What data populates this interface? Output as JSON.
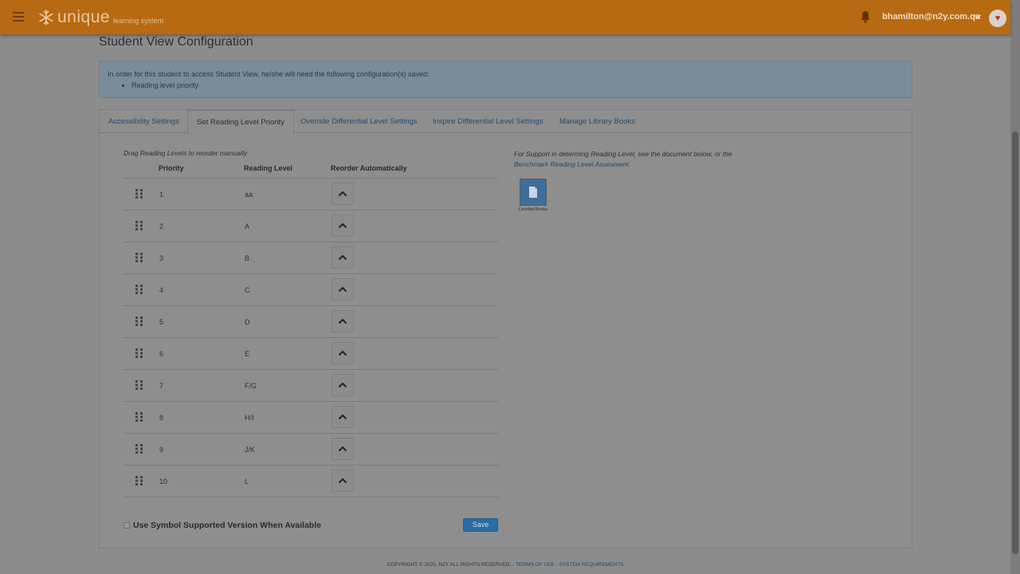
{
  "header": {
    "brand": "unique",
    "brand_sub": "learning system",
    "user_email": "bhamilton@n2y.com.qa"
  },
  "page": {
    "title": "Student View Configuration"
  },
  "notice": {
    "text": "In order for this student to access Student View, he/she will need the following configuration(s) saved:",
    "items": [
      "Reading level priority"
    ]
  },
  "tabs": [
    {
      "label": "Accessibility Settings",
      "active": false
    },
    {
      "label": "Set Reading Level Priority",
      "active": true
    },
    {
      "label": "Override Differential Level Settings",
      "active": false
    },
    {
      "label": "Inspire Differential Level Settings",
      "active": false
    },
    {
      "label": "Manage Library Books",
      "active": false
    }
  ],
  "priority": {
    "instruction": "Drag Reading Levels to reorder manually",
    "columns": {
      "priority": "Priority",
      "reading_level": "Reading Level",
      "reorder": "Reorder Automatically"
    },
    "rows": [
      {
        "priority": "1",
        "level": "aa"
      },
      {
        "priority": "2",
        "level": "A"
      },
      {
        "priority": "3",
        "level": "B"
      },
      {
        "priority": "4",
        "level": "C"
      },
      {
        "priority": "5",
        "level": "D"
      },
      {
        "priority": "6",
        "level": "E"
      },
      {
        "priority": "7",
        "level": "F/G"
      },
      {
        "priority": "8",
        "level": "H/I"
      },
      {
        "priority": "9",
        "level": "J/K"
      },
      {
        "priority": "10",
        "level": "L"
      }
    ]
  },
  "support": {
    "text": "For Support in determing Reading Level, see the document below, or the",
    "link": "Benchmark Reading Level Assesment.",
    "doc_label": "Leveled Books"
  },
  "options": {
    "symbol_label": "Use Symbol Supported Version When Available",
    "save_label": "Save"
  },
  "footer": {
    "copyright": "COPYRIGHT © 2020, N2Y ALL RIGHTS RESERVED. -",
    "terms": "TERMS OF USE",
    "separator": " - ",
    "requirements": "SYSTEM REQUIREMENTS"
  },
  "colors": {
    "topbar": "#b86a12",
    "accent_link": "#244a6c",
    "save_button": "#2a6ca0"
  }
}
